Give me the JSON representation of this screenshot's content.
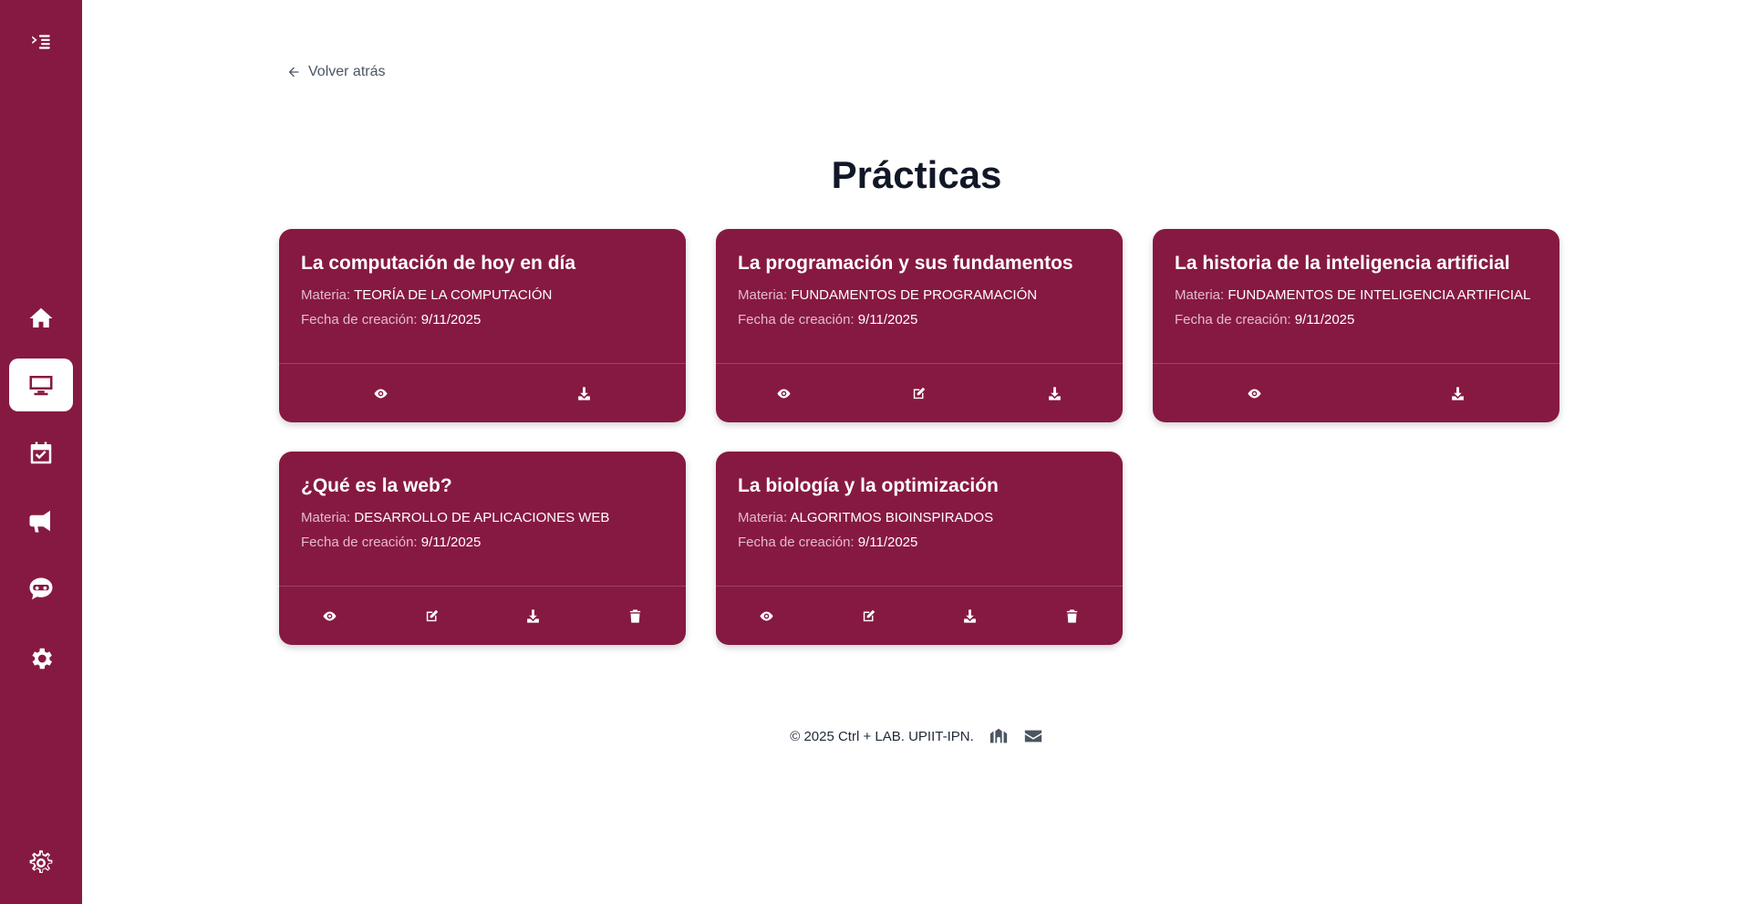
{
  "sidebar": {
    "items": [
      {
        "icon": "home-icon"
      },
      {
        "icon": "desktop-icon",
        "active": true
      },
      {
        "icon": "calendar-check-icon"
      },
      {
        "icon": "megaphone-icon"
      },
      {
        "icon": "chatbot-icon"
      },
      {
        "icon": "gear-icon"
      }
    ],
    "bottom_icon": "settings-outline-icon"
  },
  "back_label": "Volver atrás",
  "page_title": "Prácticas",
  "labels": {
    "materia": "Materia:",
    "fecha": "Fecha de creación:"
  },
  "cards": [
    {
      "title": "La computación de hoy en día",
      "materia": "TEORÍA DE LA COMPUTACIÓN",
      "fecha": "9/11/2025",
      "actions": [
        "view",
        "download"
      ]
    },
    {
      "title": "La programación y sus fundamentos",
      "materia": "FUNDAMENTOS DE PROGRAMACIÓN",
      "fecha": "9/11/2025",
      "actions": [
        "view",
        "edit",
        "download"
      ]
    },
    {
      "title": "La historia de la inteligencia artificial",
      "materia": "FUNDAMENTOS DE INTELIGENCIA ARTIFICIAL",
      "fecha": "9/11/2025",
      "actions": [
        "view",
        "download"
      ]
    },
    {
      "title": "¿Qué es la web?",
      "materia": "DESARROLLO DE APLICACIONES WEB",
      "fecha": "9/11/2025",
      "actions": [
        "view",
        "edit",
        "download",
        "delete"
      ]
    },
    {
      "title": "La biología y la optimización",
      "materia": "ALGORITMOS BIOINSPIRADOS",
      "fecha": "9/11/2025",
      "actions": [
        "view",
        "edit",
        "download",
        "delete"
      ]
    }
  ],
  "footer": {
    "text": "© 2025 Ctrl + LAB. UPIIT-IPN."
  },
  "colors": {
    "brand": "#861942",
    "label": "#e3bccb"
  }
}
